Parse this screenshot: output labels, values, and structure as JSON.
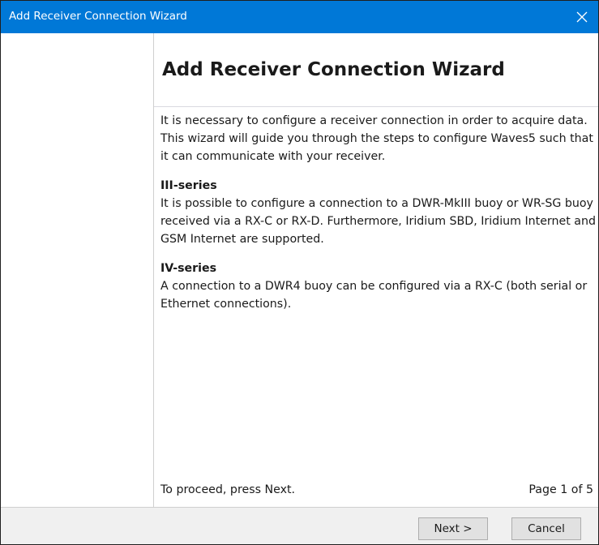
{
  "window": {
    "title": "Add Receiver Connection Wizard",
    "close_glyph": "✕"
  },
  "main": {
    "heading": "Add Receiver Connection Wizard",
    "intro": "It is necessary to configure a receiver connection in order to acquire data. This wizard will guide you through the steps to configure Waves5 such that it can communicate with your receiver.",
    "sections": [
      {
        "title": "III-series",
        "text": "It is possible to configure a connection to a DWR-MkIII buoy or WR-SG buoy received via a RX-C or RX-D. Furthermore, Iridium SBD, Iridium Internet and GSM Internet are supported."
      },
      {
        "title": "IV-series",
        "text": "A connection to a DWR4 buoy can be configured via a RX-C (both serial or Ethernet connections)."
      }
    ],
    "footer_hint": "To proceed, press Next.",
    "page_indicator": "Page 1 of 5"
  },
  "buttons": {
    "next_label": "Next >",
    "cancel_label": "Cancel"
  },
  "colors": {
    "titlebar": "#0078d7",
    "button_bar": "#f0f0f0"
  }
}
